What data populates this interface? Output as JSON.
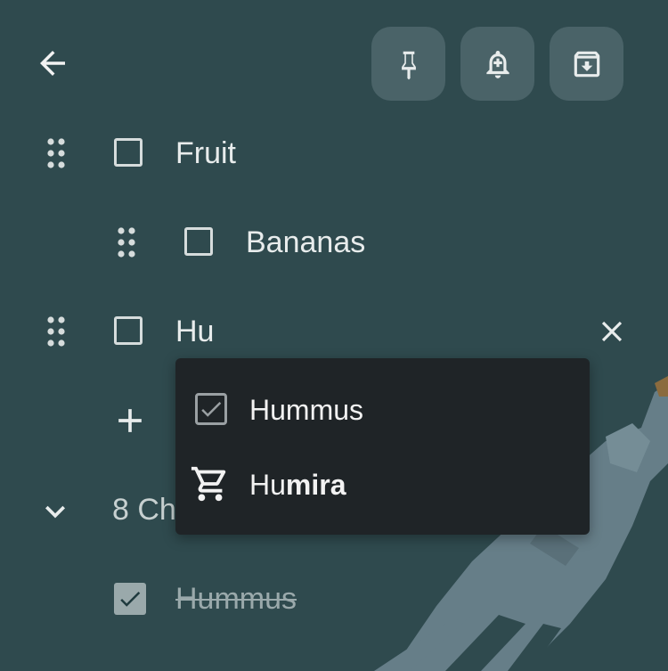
{
  "header": {
    "back": "back-arrow-icon",
    "pin": "pin-icon",
    "reminder": "add-reminder-bell-icon",
    "archive": "archive-icon"
  },
  "list": {
    "items": [
      {
        "label": "Fruit",
        "checked": false
      },
      {
        "label": "Bananas",
        "checked": false
      },
      {
        "label": "Hu",
        "checked": false
      }
    ],
    "add_icon": "plus-icon",
    "clear_icon": "close-icon"
  },
  "suggestions": [
    {
      "typed": "",
      "rest": "Hummus",
      "icon": "checkbox-checked-icon"
    },
    {
      "typed": "Hu",
      "rest": "mira",
      "icon": "cart-icon"
    }
  ],
  "checked_section": {
    "summary": "8 Ch",
    "items": [
      {
        "label": "Hummus",
        "checked": true
      }
    ]
  },
  "colors": {
    "background": "#2f4a4e",
    "button": "#4a6368",
    "popup": "#1f2427",
    "illustration": "#667e88"
  }
}
